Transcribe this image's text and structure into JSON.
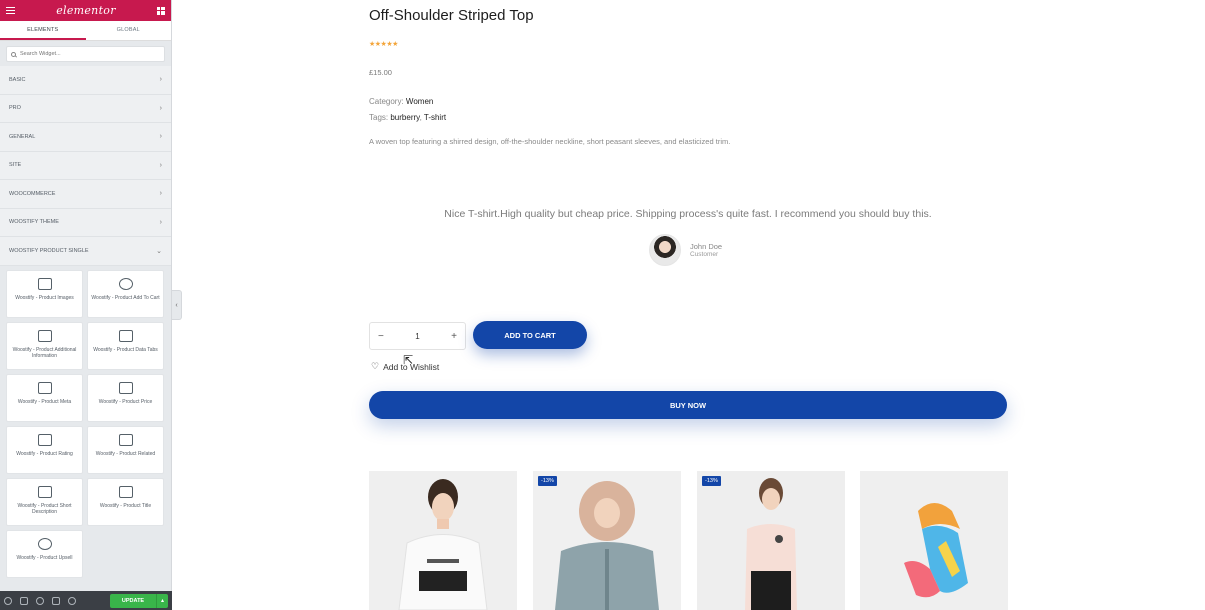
{
  "sidebar": {
    "logo": "elementor",
    "tabs": [
      {
        "label": "ELEMENTS",
        "active": true
      },
      {
        "label": "GLOBAL",
        "active": false
      }
    ],
    "search_placeholder": "Search Widget...",
    "categories": [
      {
        "label": "BASIC",
        "chevron": "›"
      },
      {
        "label": "PRO",
        "chevron": "›"
      },
      {
        "label": "GENERAL",
        "chevron": "›"
      },
      {
        "label": "SITE",
        "chevron": "›"
      },
      {
        "label": "WOOCOMMERCE",
        "chevron": "›"
      },
      {
        "label": "WOOSTIFY THEME",
        "chevron": "›"
      },
      {
        "label": "WOOSTIFY PRODUCT SINGLE",
        "chevron": "⌄"
      }
    ],
    "widgets": [
      {
        "label": "Woostify - Product Images",
        "icon": "product-images-icon"
      },
      {
        "label": "Woostify - Product Add To Cart",
        "icon": "add-to-cart-icon"
      },
      {
        "label": "Woostify - Product Additional Information",
        "icon": "info-icon"
      },
      {
        "label": "Woostify - Product Data Tabs",
        "icon": "tabs-icon"
      },
      {
        "label": "Woostify - Product Meta",
        "icon": "meta-icon"
      },
      {
        "label": "Woostify - Product Price",
        "icon": "price-icon"
      },
      {
        "label": "Woostify - Product Rating",
        "icon": "rating-icon"
      },
      {
        "label": "Woostify - Product Related",
        "icon": "related-icon"
      },
      {
        "label": "Woostify - Product Short Description",
        "icon": "description-icon"
      },
      {
        "label": "Woostify - Product Title",
        "icon": "title-icon"
      },
      {
        "label": "Woostify - Product Upsell",
        "icon": "upsell-icon"
      }
    ],
    "footer": {
      "update_label": "UPDATE",
      "caret": "▴"
    },
    "collapse_glyph": "‹"
  },
  "product": {
    "title": "Off-Shoulder Striped Top",
    "rating_stars": "★★★★★",
    "rating": 5,
    "price": "£15.00",
    "category_label": "Category:",
    "category_value": "Women",
    "tags_label": "Tags:",
    "tags": [
      "burberry",
      "T-shirt"
    ],
    "tag_separator": ",",
    "description": "A woven top featuring a shirred design, off-the-shoulder neckline, short peasant sleeves, and elasticized trim."
  },
  "testimonial": {
    "quote": "Nice T-shirt.High quality but cheap price. Shipping process's quite fast. I recommend you should buy this.",
    "author_name": "John Doe",
    "author_role": "Customer"
  },
  "cart": {
    "minus": "−",
    "quantity": "1",
    "plus": "+",
    "add_to_cart_label": "ADD TO CART",
    "wishlist_label": "Add to Wishlist",
    "buy_now_label": "BUY NOW"
  },
  "related": [
    {
      "badge": "",
      "image": "woman-in-white-graphic-tee"
    },
    {
      "badge": "-13%",
      "image": "woman-in-grey-fur-hood-jacket"
    },
    {
      "badge": "-13%",
      "image": "woman-in-pink-tshirt"
    },
    {
      "badge": "",
      "image": "colorful-silk-scarf"
    }
  ],
  "colors": {
    "elementor_brand": "#c7194e",
    "primary_button": "#1346a8",
    "update_button": "#39b54a",
    "star": "#f3a53a"
  }
}
